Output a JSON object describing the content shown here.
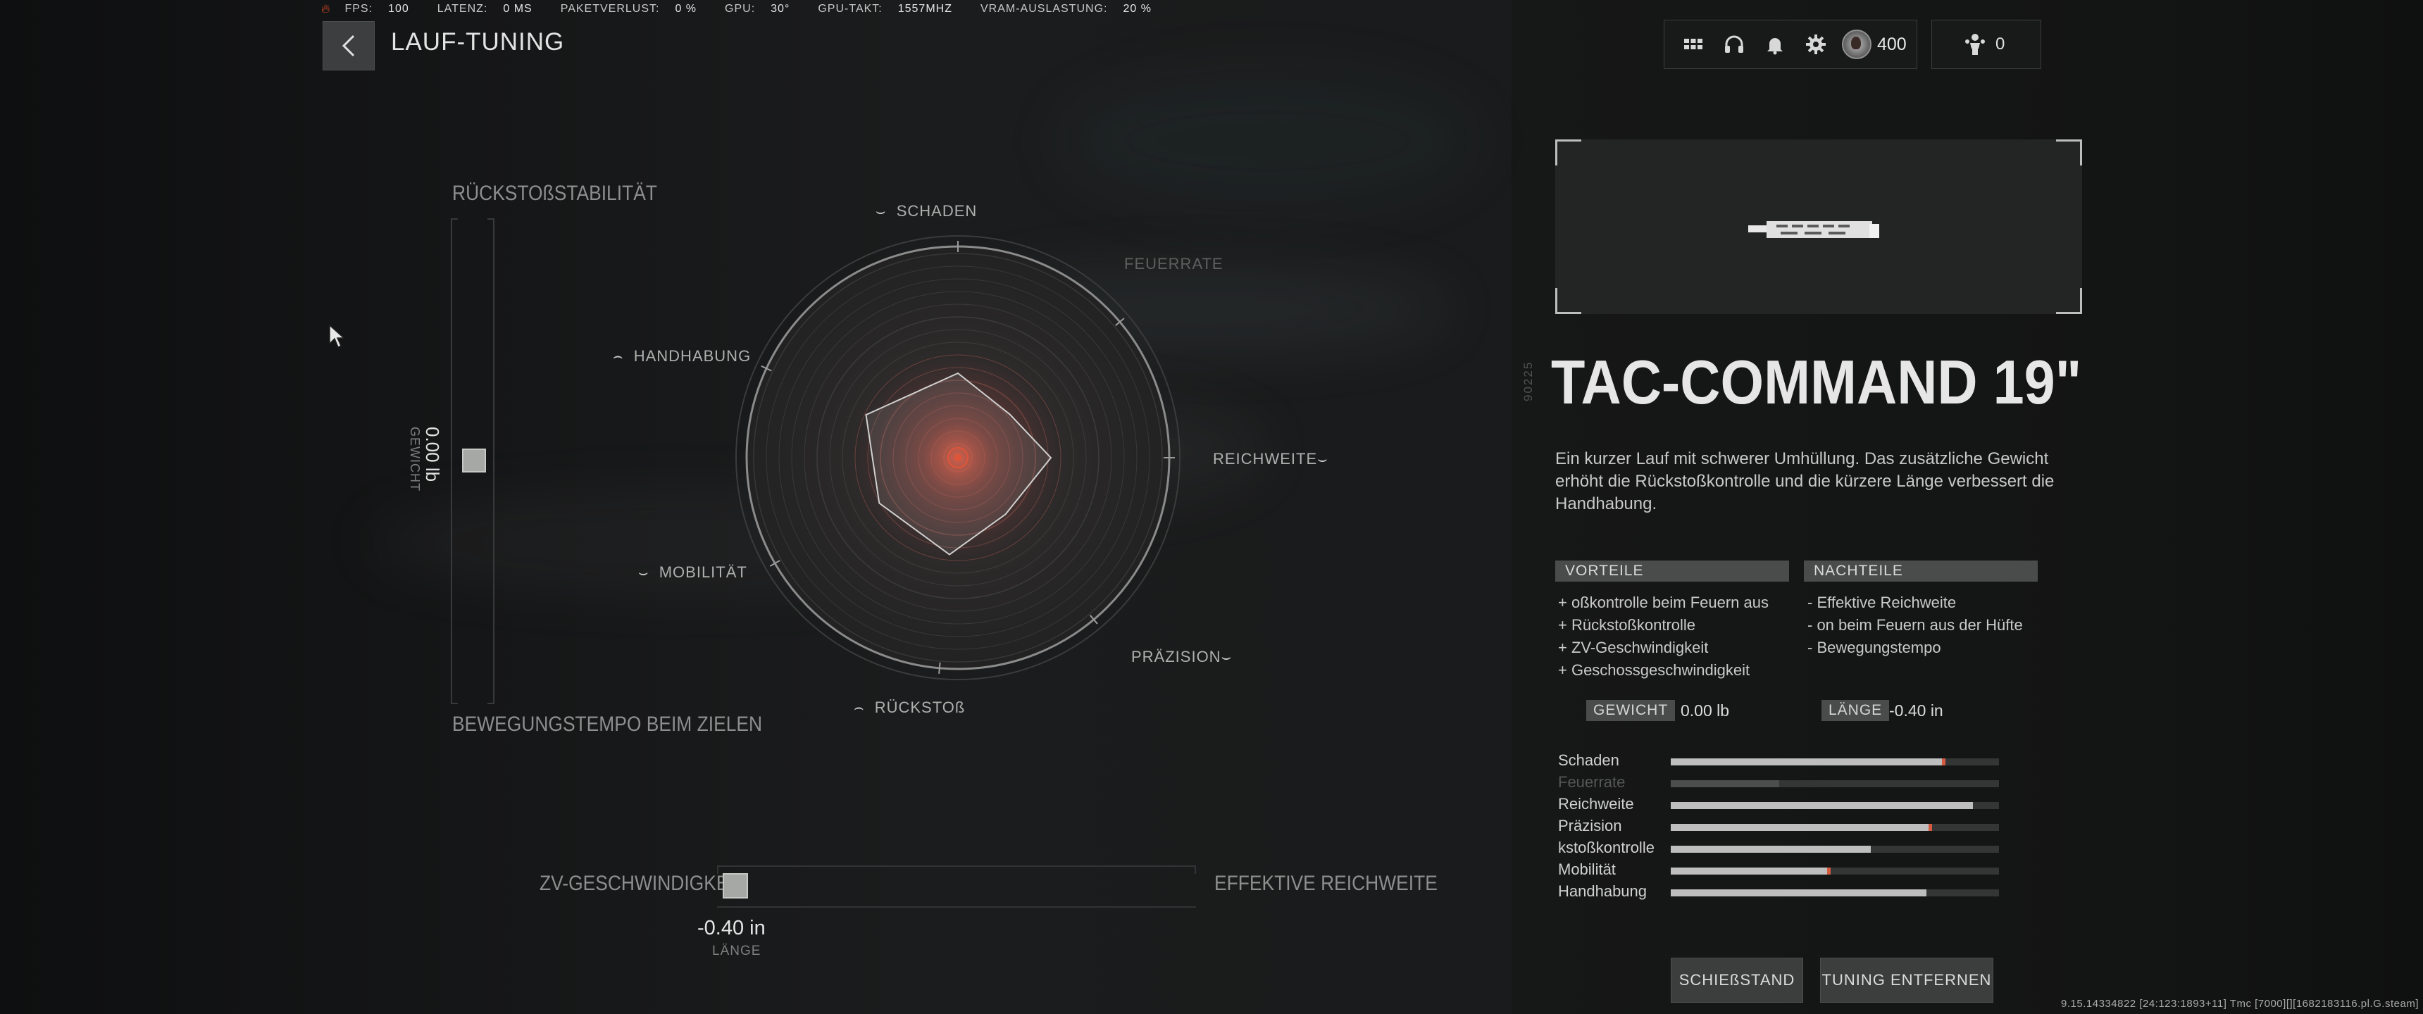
{
  "status_bar": [
    {
      "label": "FPS:",
      "value": "100"
    },
    {
      "label": "LATENZ:",
      "value": "0 MS"
    },
    {
      "label": "PAKETVERLUST:",
      "value": "0 %"
    },
    {
      "label": "GPU:",
      "value": "30°"
    },
    {
      "label": "GPU-TAKT:",
      "value": "1557MHZ"
    },
    {
      "label": "VRAM-AUSLASTUNG:",
      "value": "20 %"
    }
  ],
  "header": {
    "title": "LAUF-TUNING",
    "cod_points": "400",
    "party_count": "0",
    "icons": [
      "grid-icon",
      "headset-icon",
      "bell-icon",
      "gear-icon"
    ]
  },
  "tuning": {
    "vertical": {
      "top_label": "RÜCKSTOßSTABILITÄT",
      "bottom_label": "BEWEGUNGSTEMPO BEIM ZIELEN",
      "value": "0.00 lb",
      "value_label": "GEWICHT",
      "position": 0.5
    },
    "horizontal": {
      "left_label": "ZV-GESCHWINDIGKEIT",
      "right_label": "EFFEKTIVE REICHWEITE",
      "value": "-0.40 in",
      "value_label": "LÄNGE",
      "position": 0.0
    }
  },
  "radar": {
    "labels": {
      "damage": "SCHADEN",
      "fire_rate": "FEUERRATE",
      "range": "REICHWEITE",
      "accuracy": "PRÄZISION",
      "recoil": "RÜCKSTOß",
      "mobility": "MOBILITÄT",
      "handling": "HANDHABUNG"
    },
    "values": {
      "damage": 0.4,
      "fire_rate": 0.32,
      "range": 0.44,
      "accuracy": 0.35,
      "recoil": 0.46,
      "mobility": 0.43,
      "handling": 0.48
    }
  },
  "attachment": {
    "code": "90225",
    "name": "TAC-COMMAND 19\"",
    "description": "Ein kurzer Lauf mit schwerer Umhüllung. Das zusätzliche Gewicht erhöht die Rückstoßkontrolle und die kürzere Länge verbessert die Handhabung.",
    "pros_title": "VORTEILE",
    "cons_title": "NACHTEILE",
    "pros": [
      "+ oßkontrolle beim Feuern aus",
      "+ Rückstoßkontrolle",
      "+ ZV-Geschwindigkeit",
      "+ Geschossgeschwindigkeit"
    ],
    "cons": [
      "- Effektive Reichweite",
      "- on beim Feuern aus der Hüfte",
      "- Bewegungstempo"
    ],
    "weight_label": "GEWICHT",
    "weight_value": "0.00  lb",
    "length_label": "LÄNGE",
    "length_value": "-0.40  in"
  },
  "stats": [
    {
      "name": "Schaden",
      "value": 0.83,
      "tick": 0.83,
      "dim": false
    },
    {
      "name": "Feuerrate",
      "value": 0.33,
      "tick": null,
      "dim": true
    },
    {
      "name": "Reichweite",
      "value": 0.92,
      "tick": null,
      "dim": false
    },
    {
      "name": "Präzision",
      "value": 0.79,
      "tick": 0.79,
      "dim": false
    },
    {
      "name": "kstoßkontrolle",
      "value": 0.61,
      "tick": null,
      "dim": false
    },
    {
      "name": "Mobilität",
      "value": 0.48,
      "tick": 0.48,
      "dim": false
    },
    {
      "name": "Handhabung",
      "value": 0.78,
      "tick": null,
      "dim": false
    }
  ],
  "buttons": {
    "firing_range": "SCHIEßSTAND",
    "remove_tuning": "TUNING ENTFERNEN"
  },
  "build_info": "9.15.14334822 [24:123:1893+11] Tmc [7000][][1682183116.pl.G.steam]",
  "colors": {
    "accent_tick": "#d45a40",
    "bar_fill": "#bdbebd",
    "radar_core": "#e0553a"
  }
}
